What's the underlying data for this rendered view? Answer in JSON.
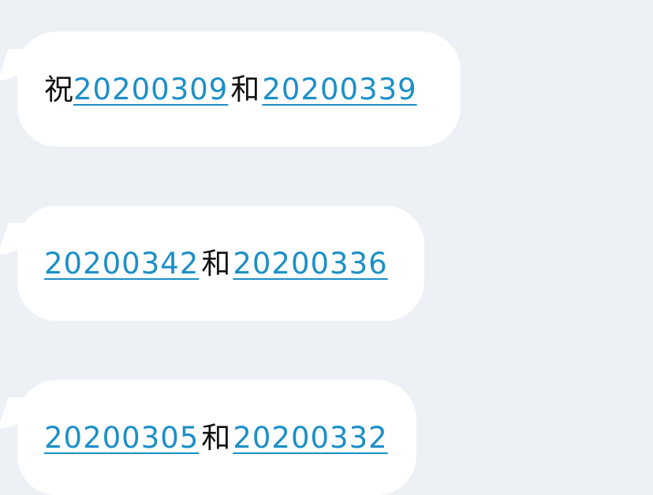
{
  "messages": [
    {
      "prefix": "祝",
      "link1": "20200309",
      "sep": "和",
      "link2": "20200339"
    },
    {
      "prefix": "",
      "link1": "20200342",
      "sep": "和",
      "link2": "20200336"
    },
    {
      "prefix": "",
      "link1": "20200305",
      "sep": "和",
      "link2": "20200332"
    }
  ],
  "colors": {
    "background": "#edf1f6",
    "bubble": "#ffffff",
    "link": "#1c8fc7",
    "text": "#111111"
  }
}
